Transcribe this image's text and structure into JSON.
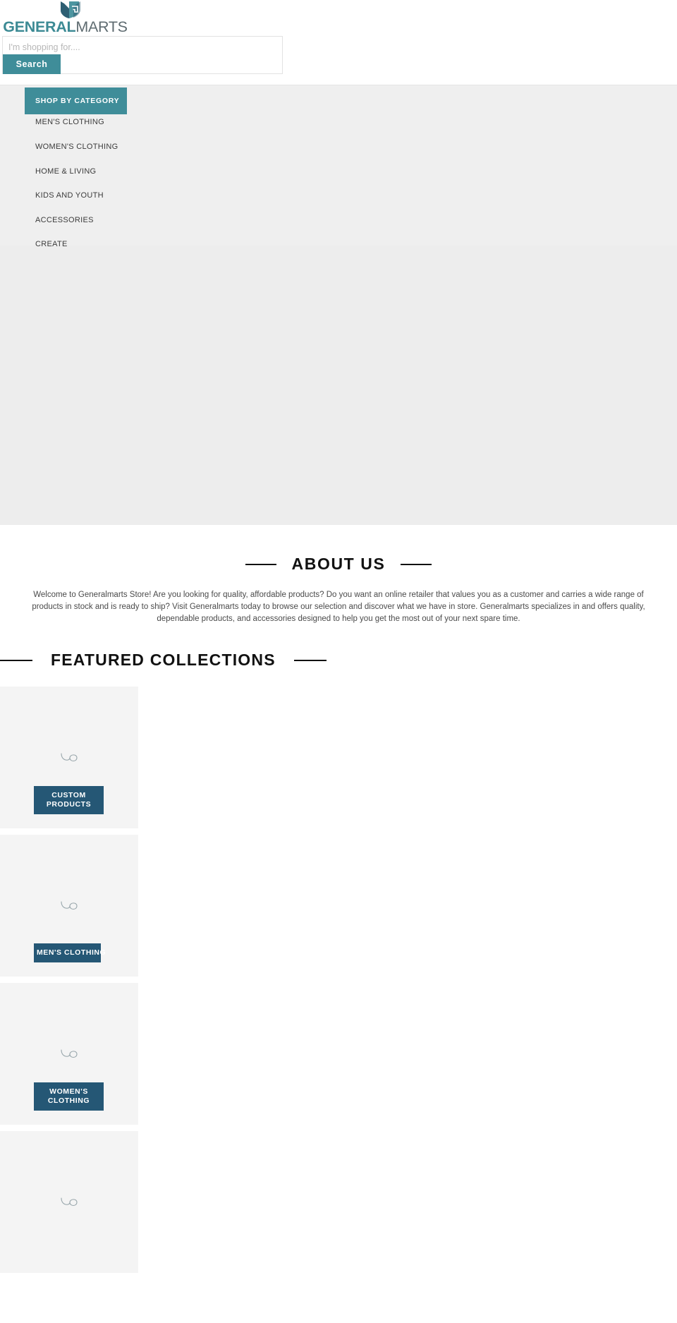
{
  "header": {
    "logo": {
      "icon": "shield-monogram-logo",
      "text_bold": "GENERAL",
      "text_light": "MARTS",
      "color_teal": "#3c8a94",
      "color_grey": "#5e6b70"
    },
    "search": {
      "placeholder": "I'm shopping for....",
      "value": "",
      "button_label": "Search",
      "button_color": "#3f8d99"
    }
  },
  "category_nav": {
    "title": "SHOP BY CATEGORY",
    "title_bg": "#3f8d99",
    "background": "#efefef",
    "items": [
      {
        "label": "MEN'S CLOTHING"
      },
      {
        "label": "WOMEN'S CLOTHING"
      },
      {
        "label": "HOME & LIVING"
      },
      {
        "label": "KIDS AND YOUTH"
      },
      {
        "label": "ACCESSORIES"
      },
      {
        "label": "CREATE"
      }
    ]
  },
  "hero": {
    "background": "#ededed"
  },
  "about": {
    "heading": "ABOUT US",
    "body": "Welcome to Generalmarts Store! Are you looking for quality, affordable products? Do you want an online retailer that values you as a customer and carries a wide range of products in stock and is ready to ship? Visit Generalmarts today to browse our selection and discover what we have in store. Generalmarts specializes in and offers quality, dependable products, and accessories designed to help you get the most out of your next spare time."
  },
  "featured": {
    "heading": "FEATURED COLLECTIONS",
    "button_color": "#255775",
    "card_background": "#f4f4f4",
    "cards": [
      {
        "button_label": "CUSTOM PRODUCTS",
        "icon": "loading-spinner-icon",
        "two_line": true
      },
      {
        "button_label": "MEN'S CLOTHING",
        "icon": "loading-spinner-icon",
        "two_line": false
      },
      {
        "button_label": "WOMEN'S CLOTHING",
        "icon": "loading-spinner-icon",
        "two_line": true
      },
      {
        "button_label": "",
        "icon": "loading-spinner-icon",
        "two_line": false
      }
    ]
  }
}
